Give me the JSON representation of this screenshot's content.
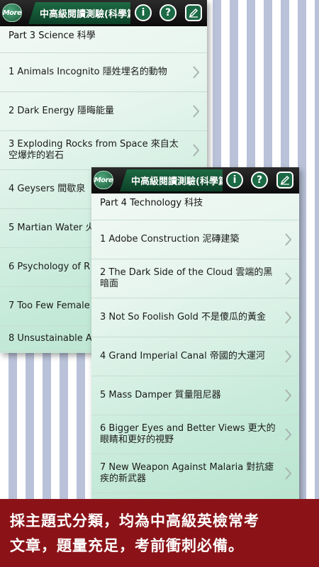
{
  "screen_a": {
    "more_label": "More",
    "title": "中高級閱讀測驗(科學篇)",
    "part_header": "Part 3 Science 科學",
    "items": [
      {
        "label": "1 Animals Incognito 隱姓埋名的動物"
      },
      {
        "label": "2 Dark Energy 隱晦能量"
      },
      {
        "label": "3 Exploding Rocks from Space 來自太空爆炸的岩石"
      },
      {
        "label": "4 Geysers 間歇泉"
      },
      {
        "label": "5 Martian Water 火"
      },
      {
        "label": "6 Psychology of R"
      },
      {
        "label": "7 Too Few Female"
      },
      {
        "label": "8 Unsustainable A"
      }
    ]
  },
  "screen_b": {
    "more_label": "More",
    "title": "中高級閱讀測驗(科學篇)",
    "part_header": "Part 4 Technology 科技",
    "items": [
      {
        "label": "1 Adobe Construction 泥磚建築"
      },
      {
        "label": "2 The Dark Side of the Cloud 雲端的黑暗面"
      },
      {
        "label": "3 Not So Foolish Gold 不是傻瓜的黃金"
      },
      {
        "label": "4 Grand Imperial Canal 帝國的大運河"
      },
      {
        "label": "5 Mass Damper 質量阻尼器"
      },
      {
        "label": "6 Bigger Eyes and Better Views 更大的眼睛和更好的視野"
      },
      {
        "label": "7 New Weapon Against Malaria 對抗瘧疾的新武器"
      }
    ]
  },
  "icons": {
    "info_glyph": "i",
    "help_glyph": "?"
  },
  "banner": {
    "line1": "採主題式分類，均為中高級英檢常考",
    "line2": "文章，題量充足，考前衝刺必備。"
  }
}
